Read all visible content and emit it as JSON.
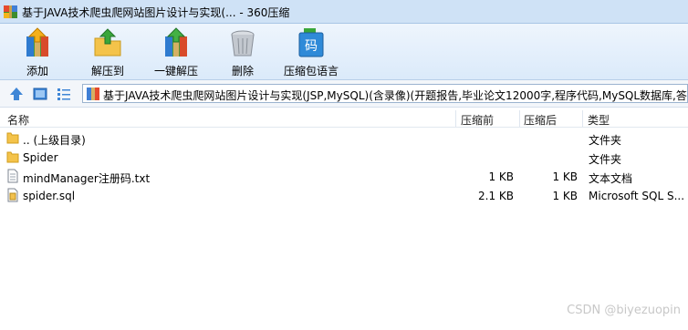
{
  "window": {
    "title": "基于JAVA技术爬虫爬网站图片设计与实现(... - 360压缩"
  },
  "toolbar": {
    "add": "添加",
    "extract_to": "解压到",
    "one_click_extract": "一键解压",
    "delete": "删除",
    "language_pack": "压缩包语言",
    "language_icon_char": "码"
  },
  "address": {
    "path": "基于JAVA技术爬虫爬网站图片设计与实现(JSP,MySQL)(含录像)(开题报告,毕业论文12000字,程序代码,MySQL数据库,答辩"
  },
  "columns": {
    "name": "名称",
    "compressed_before": "压缩前",
    "compressed_after": "压缩后",
    "type": "类型"
  },
  "files": [
    {
      "name": ".. (上级目录)",
      "size_before": "",
      "size_after": "",
      "type": "文件夹",
      "icon": "folder-icon"
    },
    {
      "name": "Spider",
      "size_before": "",
      "size_after": "",
      "type": "文件夹",
      "icon": "folder-icon"
    },
    {
      "name": "mindManager注册码.txt",
      "size_before": "1 KB",
      "size_after": "1 KB",
      "type": "文本文档",
      "icon": "text-file-icon"
    },
    {
      "name": "spider.sql",
      "size_before": "2.1 KB",
      "size_after": "1 KB",
      "type": "Microsoft SQL S...",
      "icon": "sql-file-icon"
    }
  ],
  "watermark": "CSDN @biyezuopin"
}
